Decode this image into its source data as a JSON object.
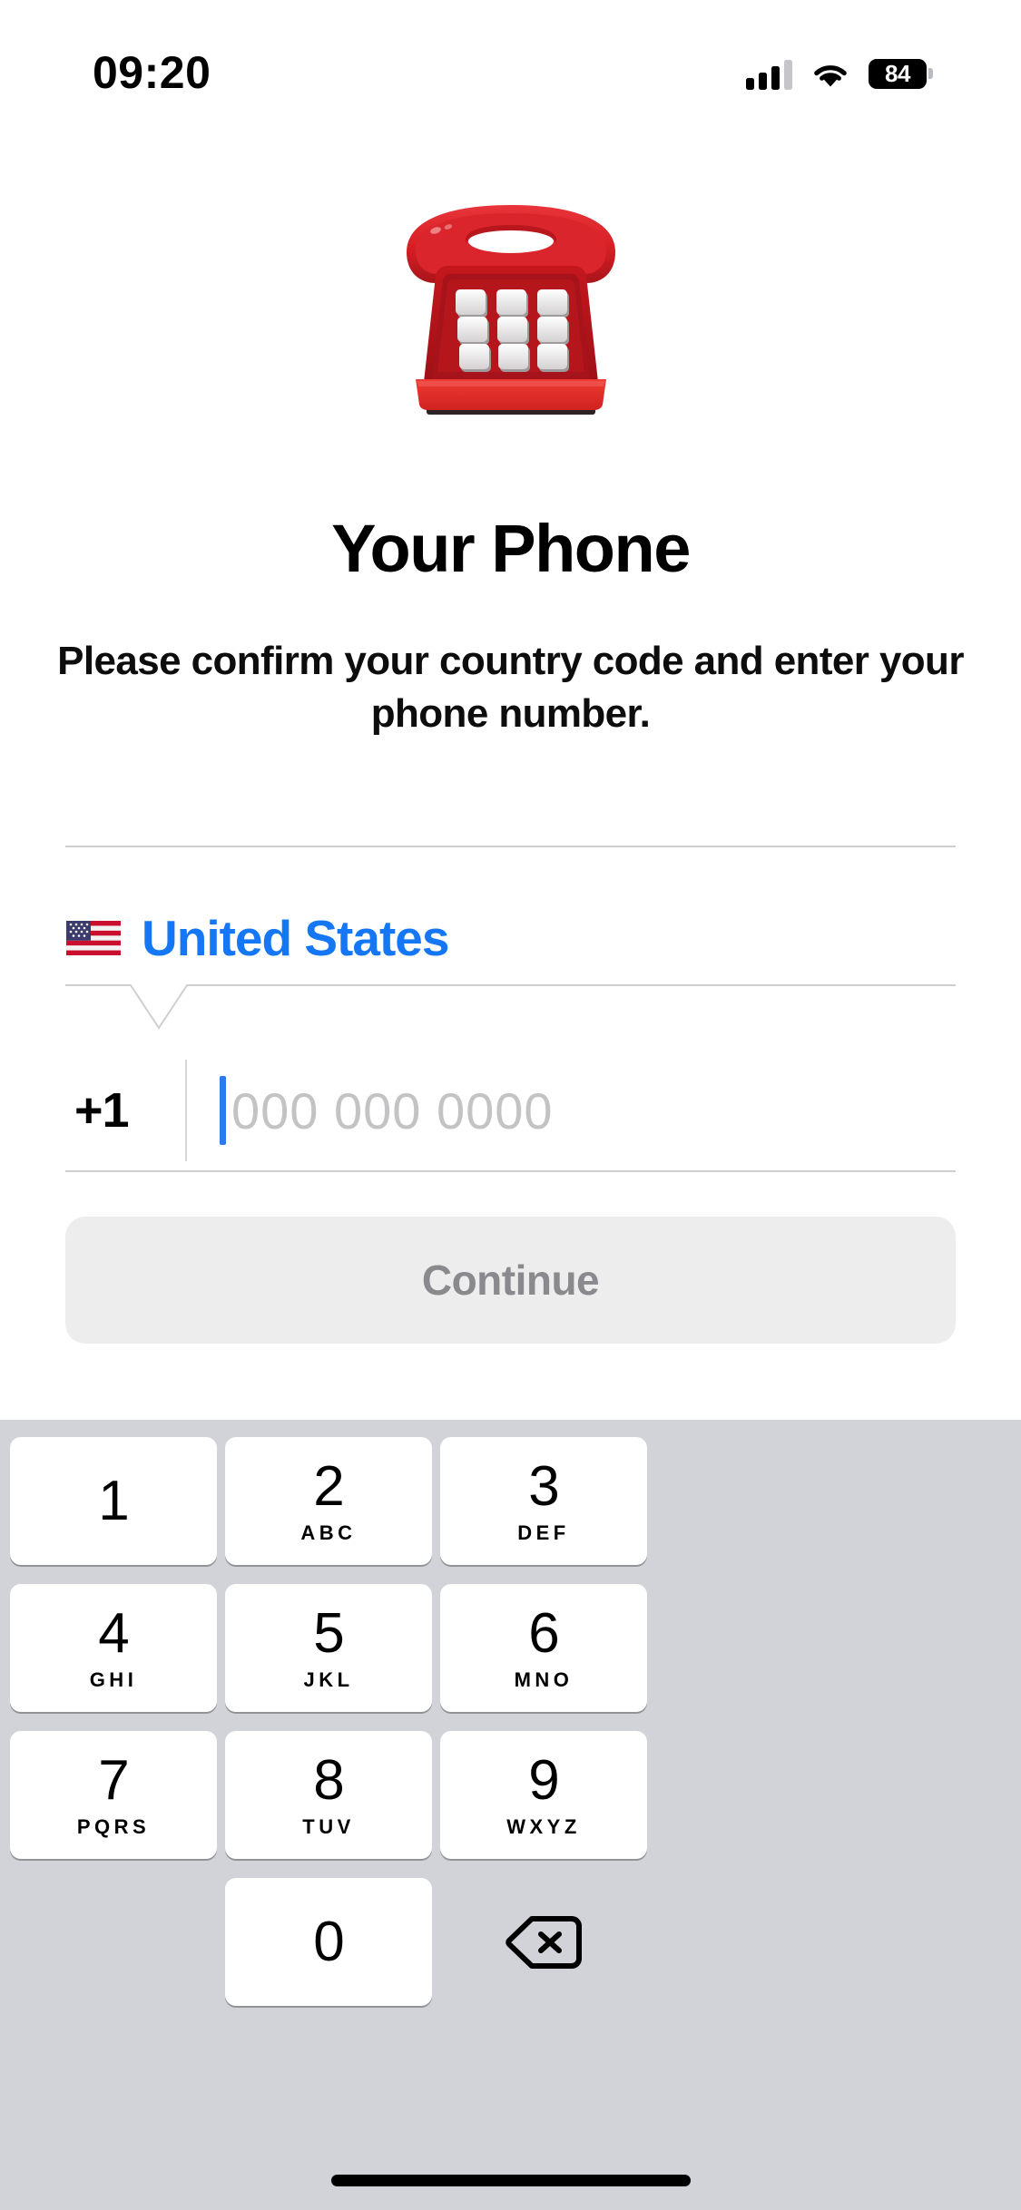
{
  "status_bar": {
    "time": "09:20",
    "battery_percent": "84",
    "signal_icon": "cellular-bars-icon",
    "wifi_icon": "wifi-icon",
    "battery_icon": "battery-icon"
  },
  "hero": {
    "emoji": "☎️",
    "emoji_name": "telephone-emoji"
  },
  "main": {
    "title": "Your Phone",
    "subtitle": "Please confirm your country code and enter your phone number."
  },
  "country": {
    "flag": "🇺🇸",
    "flag_name": "us-flag-icon",
    "name": "United States",
    "accent_color": "#1677F6"
  },
  "phone_input": {
    "dial_code": "+1",
    "value": "",
    "placeholder": "000 000 0000",
    "caret_color": "#2B7BEE"
  },
  "continue": {
    "label": "Continue",
    "enabled": false,
    "background_color": "#EDEDEE",
    "text_color": "#8A8A8E"
  },
  "keypad": {
    "background_color": "#D1D3D9",
    "key_color": "#FFFFFF",
    "rows": [
      [
        {
          "digit": "1",
          "letters": ""
        },
        {
          "digit": "2",
          "letters": "ABC"
        },
        {
          "digit": "3",
          "letters": "DEF"
        }
      ],
      [
        {
          "digit": "4",
          "letters": "GHI"
        },
        {
          "digit": "5",
          "letters": "JKL"
        },
        {
          "digit": "6",
          "letters": "MNO"
        }
      ],
      [
        {
          "digit": "7",
          "letters": "PQRS"
        },
        {
          "digit": "8",
          "letters": "TUV"
        },
        {
          "digit": "9",
          "letters": "WXYZ"
        }
      ]
    ],
    "zero_key": {
      "digit": "0",
      "letters": ""
    },
    "backspace_icon": "backspace-delete-icon"
  },
  "home_indicator": "home-indicator"
}
